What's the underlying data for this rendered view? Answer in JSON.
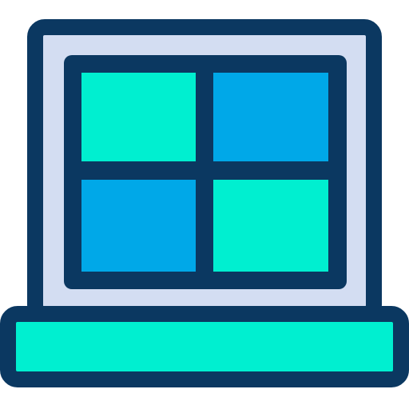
{
  "icon": {
    "name": "window-icon",
    "colors": {
      "outline": "#0b3861",
      "frame": "#d3ddf2",
      "pane_teal": "#00efd0",
      "pane_blue": "#00a8e8",
      "sill": "#00efd0"
    }
  }
}
